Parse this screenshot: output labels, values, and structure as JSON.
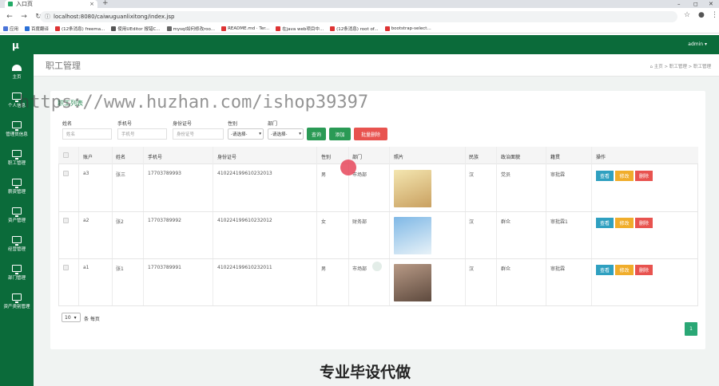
{
  "browser": {
    "tab_title": "入口页",
    "url": "localhost:8080/caiwuguanlixitong/index.jsp",
    "bookmarks": [
      "应用",
      "百度翻译",
      "(12条消息) freema...",
      "使用UEditor 报错C...",
      "mysql如何修改roo...",
      "README.md · Ter...",
      "在java web项目中...",
      "(12条消息) root of...",
      "bootstrap-select..."
    ],
    "bookmark_colors": [
      "#4a73d8",
      "#2a6fd6",
      "#d33",
      "#555",
      "#666",
      "#d33",
      "#d33",
      "#d33",
      "#d33"
    ]
  },
  "header": {
    "logo": "μ",
    "user": "admin ▾"
  },
  "sidebar": {
    "items": [
      {
        "label": "主页",
        "icon": "dashboard-icon"
      },
      {
        "label": "个人信息",
        "icon": "monitor-icon"
      },
      {
        "label": "管理员信息",
        "icon": "monitor-icon"
      },
      {
        "label": "职工管理",
        "icon": "monitor-icon"
      },
      {
        "label": "薪资管理",
        "icon": "monitor-icon"
      },
      {
        "label": "资产管理",
        "icon": "monitor-icon"
      },
      {
        "label": "经营管理",
        "icon": "monitor-icon"
      },
      {
        "label": "部门管理",
        "icon": "monitor-icon"
      },
      {
        "label": "资产类别管理",
        "icon": "monitor-icon"
      }
    ]
  },
  "page": {
    "title": "职工管理",
    "breadcrumb": "主页 > 职工管理 > 职工管理",
    "card_title": "职工列表"
  },
  "filters": {
    "name_label": "姓名",
    "name_placeholder": "姓名",
    "phone_label": "手机号",
    "phone_placeholder": "手机号",
    "idcard_label": "身份证号",
    "idcard_placeholder": "身份证号",
    "gender_label": "性别",
    "gender_value": "-请选择-",
    "dept_label": "部门",
    "dept_value": "-请选择-",
    "search_btn": "查询",
    "add_btn": "添加",
    "batch_delete_btn": "批量删除"
  },
  "table": {
    "columns": [
      "",
      "账户",
      "姓名",
      "手机号",
      "身份证号",
      "性别",
      "部门",
      "照片",
      "民族",
      "政治面貌",
      "籍贯",
      "操作"
    ],
    "rows": [
      {
        "account": "a3",
        "name": "张三",
        "phone": "17703789993",
        "idcard": "410224199610232013",
        "gender": "男",
        "dept": "市场部",
        "ethnic": "汉",
        "political": "党员",
        "native": "审批霖",
        "photo_colors": [
          "#f4e6b0",
          "#c9a060"
        ]
      },
      {
        "account": "a2",
        "name": "张2",
        "phone": "17703789992",
        "idcard": "410224199610232012",
        "gender": "女",
        "dept": "财务部",
        "ethnic": "汉",
        "political": "群众",
        "native": "审批霖1",
        "photo_colors": [
          "#7fb8e6",
          "#e8f2f8"
        ]
      },
      {
        "account": "a1",
        "name": "张1",
        "phone": "17703789991",
        "idcard": "410224199610232011",
        "gender": "男",
        "dept": "市场部",
        "ethnic": "汉",
        "political": "群众",
        "native": "审批霖",
        "photo_colors": [
          "#b89a86",
          "#5e4a3e"
        ]
      }
    ],
    "view_btn": "查看",
    "edit_btn": "修改",
    "delete_btn": "删除"
  },
  "pagination": {
    "page_size": "10",
    "per_page_text": "条 每页",
    "current_page": "1"
  },
  "overlays": {
    "watermark_url": "https://www.huzhan.com/ishop39397",
    "banner": "专业毕设代做"
  },
  "colors": {
    "brand": "#0b6b3a",
    "search": "#2a9a55",
    "add": "#2a9a55",
    "danger": "#e8534f",
    "view": "#2fa0c0",
    "edit": "#f0ad2b"
  }
}
